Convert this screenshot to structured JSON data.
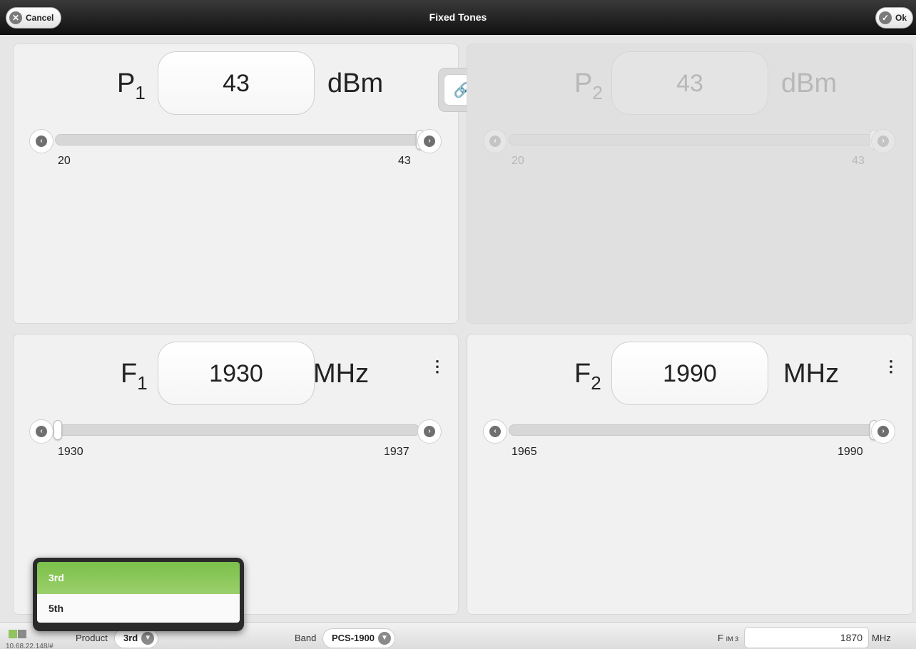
{
  "header": {
    "title": "Fixed Tones",
    "cancel_label": "Cancel",
    "ok_label": "Ok"
  },
  "p1": {
    "symbol": "P",
    "sub": "1",
    "value": "43",
    "unit": "dBm",
    "min": "20",
    "max": "43",
    "level": 1.0
  },
  "p2": {
    "symbol": "P",
    "sub": "2",
    "value": "43",
    "unit": "dBm",
    "min": "20",
    "max": "43",
    "level": 1.0
  },
  "f1": {
    "symbol": "F",
    "sub": "1",
    "value": "1930",
    "unit": "MHz",
    "min": "1930",
    "max": "1937",
    "level": 0.0
  },
  "f2": {
    "symbol": "F",
    "sub": "2",
    "value": "1990",
    "unit": "MHz",
    "min": "1965",
    "max": "1990",
    "level": 1.0
  },
  "icons": {
    "cancel": "x-circle-icon",
    "ok": "check-circle-icon",
    "link": "chain-link-icon",
    "menu": "kebab-menu-icon"
  },
  "footer": {
    "address": "10.68.22.148/#",
    "product_label": "Product",
    "product_value": "3rd",
    "band_label": "Band",
    "band_value": "PCS-1900",
    "fim_label": "F",
    "fim_sub": "IM 3",
    "fim_value": "1870",
    "fim_unit": "MHz"
  },
  "popup": {
    "options": [
      "3rd",
      "5th"
    ],
    "selected": "3rd"
  },
  "colors": {
    "accent": "#8ac65a",
    "header_bg": "#1e1e1e"
  }
}
